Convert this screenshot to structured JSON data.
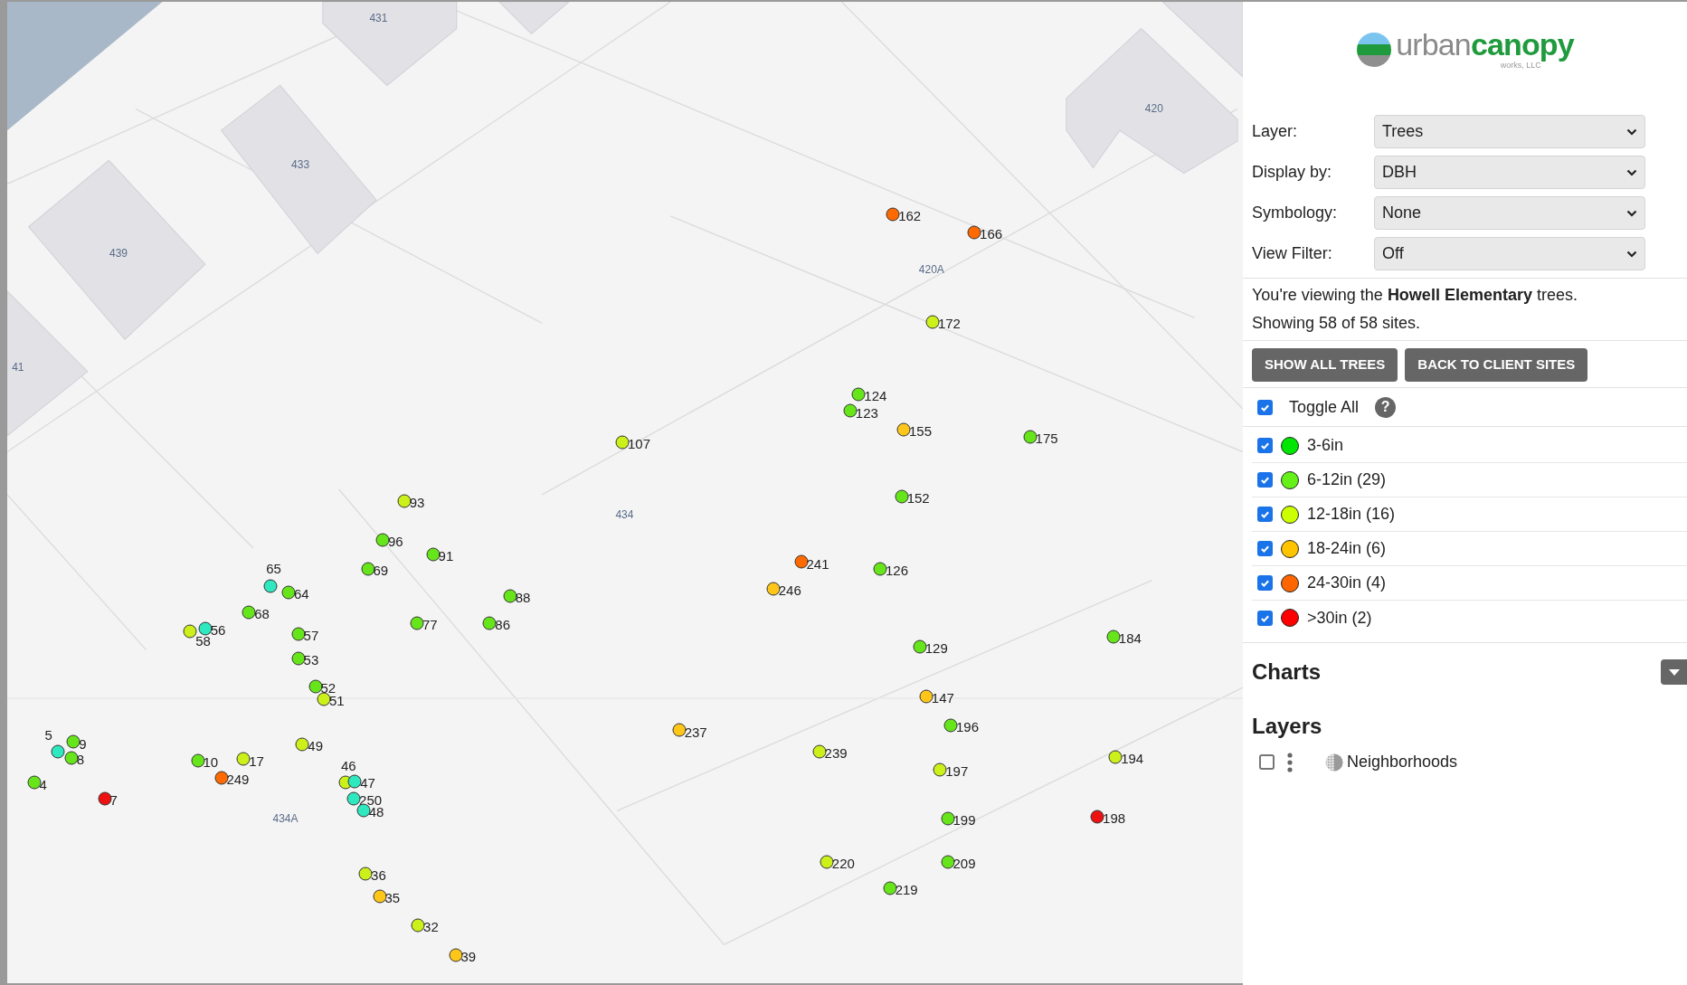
{
  "map": {
    "labels": [
      "431",
      "433",
      "439",
      "420",
      "434",
      "434A",
      "420A",
      "41"
    ],
    "trees": [
      {
        "label": "162",
        "color": "#ff6a00"
      },
      {
        "label": "166",
        "color": "#ff6a00"
      },
      {
        "label": "172",
        "color": "#ccf01a"
      },
      {
        "label": "124",
        "color": "#66e61a"
      },
      {
        "label": "123",
        "color": "#66e61a"
      },
      {
        "label": "155",
        "color": "#ffc61a"
      },
      {
        "label": "175",
        "color": "#66e61a"
      },
      {
        "label": "107",
        "color": "#ccf01a"
      },
      {
        "label": "152",
        "color": "#66e61a"
      },
      {
        "label": "93",
        "color": "#ccf01a"
      },
      {
        "label": "96",
        "color": "#66e61a"
      },
      {
        "label": "91",
        "color": "#66e61a"
      },
      {
        "label": "69",
        "color": "#66e61a"
      },
      {
        "label": "241",
        "color": "#ff6a00"
      },
      {
        "label": "126",
        "color": "#66e61a"
      },
      {
        "label": "246",
        "color": "#ffc61a"
      },
      {
        "label": "88",
        "color": "#66e61a"
      },
      {
        "label": "65",
        "color": "#2ee8c0"
      },
      {
        "label": "64",
        "color": "#66e61a"
      },
      {
        "label": "58",
        "color": "#ccf01a"
      },
      {
        "label": "56",
        "color": "#2ee8c0"
      },
      {
        "label": "68",
        "color": "#66e61a"
      },
      {
        "label": "77",
        "color": "#66e61a"
      },
      {
        "label": "86",
        "color": "#66e61a"
      },
      {
        "label": "57",
        "color": "#66e61a"
      },
      {
        "label": "53",
        "color": "#66e61a"
      },
      {
        "label": "52",
        "color": "#66e61a"
      },
      {
        "label": "51",
        "color": "#ccf01a"
      },
      {
        "label": "129",
        "color": "#66e61a"
      },
      {
        "label": "184",
        "color": "#66e61a"
      },
      {
        "label": "147",
        "color": "#ffc61a"
      },
      {
        "label": "196",
        "color": "#66e61a"
      },
      {
        "label": "237",
        "color": "#ffc61a"
      },
      {
        "label": "239",
        "color": "#ccf01a"
      },
      {
        "label": "197",
        "color": "#ccf01a"
      },
      {
        "label": "194",
        "color": "#ccf01a"
      },
      {
        "label": "5",
        "color": "#2ee8c0"
      },
      {
        "label": "9",
        "color": "#66e61a"
      },
      {
        "label": "8",
        "color": "#66e61a"
      },
      {
        "label": "4",
        "color": "#66e61a"
      },
      {
        "label": "7",
        "color": "#ee1111"
      },
      {
        "label": "10",
        "color": "#66e61a"
      },
      {
        "label": "17",
        "color": "#ccf01a"
      },
      {
        "label": "249",
        "color": "#ff6a00"
      },
      {
        "label": "49",
        "color": "#ccf01a"
      },
      {
        "label": "46",
        "color": "#ccf01a"
      },
      {
        "label": "47",
        "color": "#2ee8c0"
      },
      {
        "label": "250",
        "color": "#2ee8c0"
      },
      {
        "label": "48",
        "color": "#2ee8c0"
      },
      {
        "label": "199",
        "color": "#66e61a"
      },
      {
        "label": "198",
        "color": "#ee1111"
      },
      {
        "label": "220",
        "color": "#ccf01a"
      },
      {
        "label": "209",
        "color": "#66e61a"
      },
      {
        "label": "219",
        "color": "#66e61a"
      },
      {
        "label": "36",
        "color": "#ccf01a"
      },
      {
        "label": "35",
        "color": "#ffc61a"
      },
      {
        "label": "32",
        "color": "#ccf01a"
      },
      {
        "label": "39",
        "color": "#ffc61a"
      }
    ]
  },
  "logo": {
    "word_a": "urban",
    "word_b": "canopy",
    "tagline": "works, LLC"
  },
  "filters": [
    {
      "label": "Layer:",
      "value": "Trees"
    },
    {
      "label": "Display by:",
      "value": "DBH"
    },
    {
      "label": "Symbology:",
      "value": "None"
    },
    {
      "label": "View Filter:",
      "value": "Off"
    }
  ],
  "info": [
    "You're viewing the **Howell Elementary** trees.",
    "Showing 58 of 58 sites."
  ],
  "buttons": [
    "SHOW ALL TREES",
    "BACK TO CLIENT SITES"
  ],
  "toggle_all": {
    "label": "Toggle All",
    "checked": true,
    "help": "?"
  },
  "legend": [
    {
      "label": "3-6in",
      "color": "#00e600",
      "checked": true
    },
    {
      "label": "6-12in (29)",
      "color": "#66f01a",
      "checked": true
    },
    {
      "label": "12-18in (16)",
      "color": "#ccff00",
      "checked": true
    },
    {
      "label": "18-24in (6)",
      "color": "#ffc400",
      "checked": true
    },
    {
      "label": "24-30in (4)",
      "color": "#ff6600",
      "checked": true
    },
    {
      "label": ">30in (2)",
      "color": "#ff0000",
      "checked": true
    }
  ],
  "charts": {
    "title": "Charts",
    "expanded": false
  },
  "layers": {
    "title": "Layers",
    "items": [
      {
        "label": "Neighborhoods",
        "checked": false
      }
    ]
  }
}
